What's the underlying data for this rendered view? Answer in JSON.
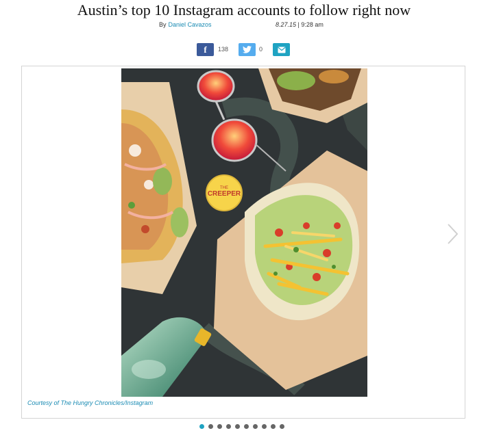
{
  "article": {
    "title": "Austin’s top 10 Instagram accounts to follow right now",
    "by_label": "By",
    "author": "Daniel Cavazos",
    "date": "8.27.15",
    "separator": " | ",
    "time": "9:28 am"
  },
  "share": {
    "facebook_icon": "f",
    "facebook_count": "138",
    "twitter_count": "0",
    "colors": {
      "facebook": "#3b5a9a",
      "twitter": "#55acee",
      "email": "#1fa3c2"
    }
  },
  "slideshow": {
    "caption": "Courtesy of The Hungry Chronicles/Instagram",
    "sticker_line1": "THE",
    "sticker_line2": "CREEPER",
    "total_slides": 10,
    "active_slide": 1
  }
}
